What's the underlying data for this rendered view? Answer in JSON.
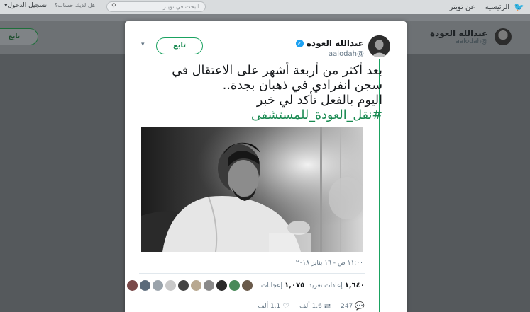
{
  "background": {
    "nav_home": "الرئيسية",
    "nav_about": "عن تويتر",
    "search_placeholder": "البحث في تويتر",
    "login_prompt": "هل لديك حساب؟",
    "login_link": "تسجيل الدخول▾",
    "follow_label": "تابع",
    "profile_name": "عبدالله العودة",
    "profile_handle": "@aalodah"
  },
  "tweet": {
    "author_name": "عبدالله العودة",
    "author_handle": "@aalodah",
    "follow_label": "تابع",
    "text_lines": [
      "بعد أكثر من أربعة أشهر على الاعتقال في",
      "سجن انفرادي في ذهبان بجدة..",
      "اليوم بالفعل تأكد لي خبر"
    ],
    "hashtag": "#نقل_العودة_للمستشفى",
    "timestamp": "١١:٠٠ ص - ١٦ يناير ٢٠١٨",
    "retweets_count": "١,٦٤٠",
    "retweets_label": "إعادات تغريد",
    "likes_count": "١,٠٧٥",
    "likes_label": "إعجابات",
    "reply_count": "247",
    "retweet_action_count": "1.6 ألف",
    "like_action_count": "1.1 ألف"
  },
  "colors": {
    "accent_green": "#1aa260",
    "verified_blue": "#1da1f2"
  },
  "icons": {
    "verified": "verified-badge-icon",
    "chevron": "chevron-down-icon",
    "reply": "reply-icon",
    "retweet": "retweet-icon",
    "like": "heart-icon",
    "search": "search-icon",
    "twitter": "twitter-bird-icon"
  }
}
